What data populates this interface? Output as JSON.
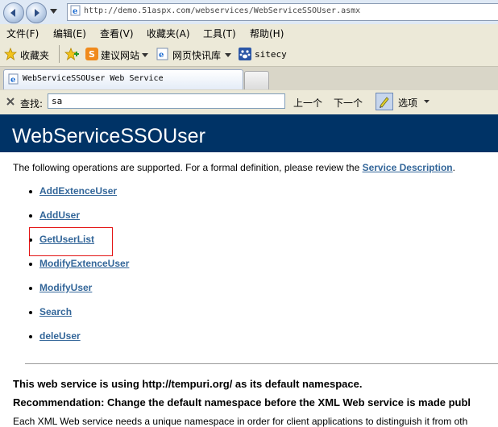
{
  "address_bar": {
    "url": "http://demo.51aspx.com/webservices/WebServiceSSOUser.asmx"
  },
  "menu": {
    "items": [
      "文件(F)",
      "编辑(E)",
      "查看(V)",
      "收藏夹(A)",
      "工具(T)",
      "帮助(H)"
    ]
  },
  "favorites_bar": {
    "favorites_label": "收藏夹",
    "suggested_sites": "建议网站",
    "web_slice_gallery": "网页快讯库",
    "sitecy": "sitecy"
  },
  "tabs": {
    "active_tab_title": "WebServiceSSOUser Web Service"
  },
  "find_bar": {
    "label": "查找:",
    "query": "sa",
    "previous": "上一个",
    "next": "下一个",
    "options": "选项"
  },
  "page": {
    "title": "WebServiceSSOUser",
    "intro_text": "The following operations are supported. For a formal definition, please review the ",
    "service_description_link": "Service Description",
    "intro_end": ".",
    "operations": [
      "AddExtenceUser",
      "AddUser",
      "GetUserList",
      "ModifyExtenceUser",
      "ModifyUser",
      "Search",
      "deleUser"
    ],
    "namespace_notice": "This web service is using http://tempuri.org/ as its default namespace.",
    "recommendation": "Recommendation: Change the default namespace before the XML Web service is made publ",
    "body_text": "Each XML Web service needs a unique namespace in order for client applications to distinguish it from oth"
  },
  "colors": {
    "header_bg": "#003366",
    "link": "#336699",
    "highlight_box": "#e31414"
  }
}
